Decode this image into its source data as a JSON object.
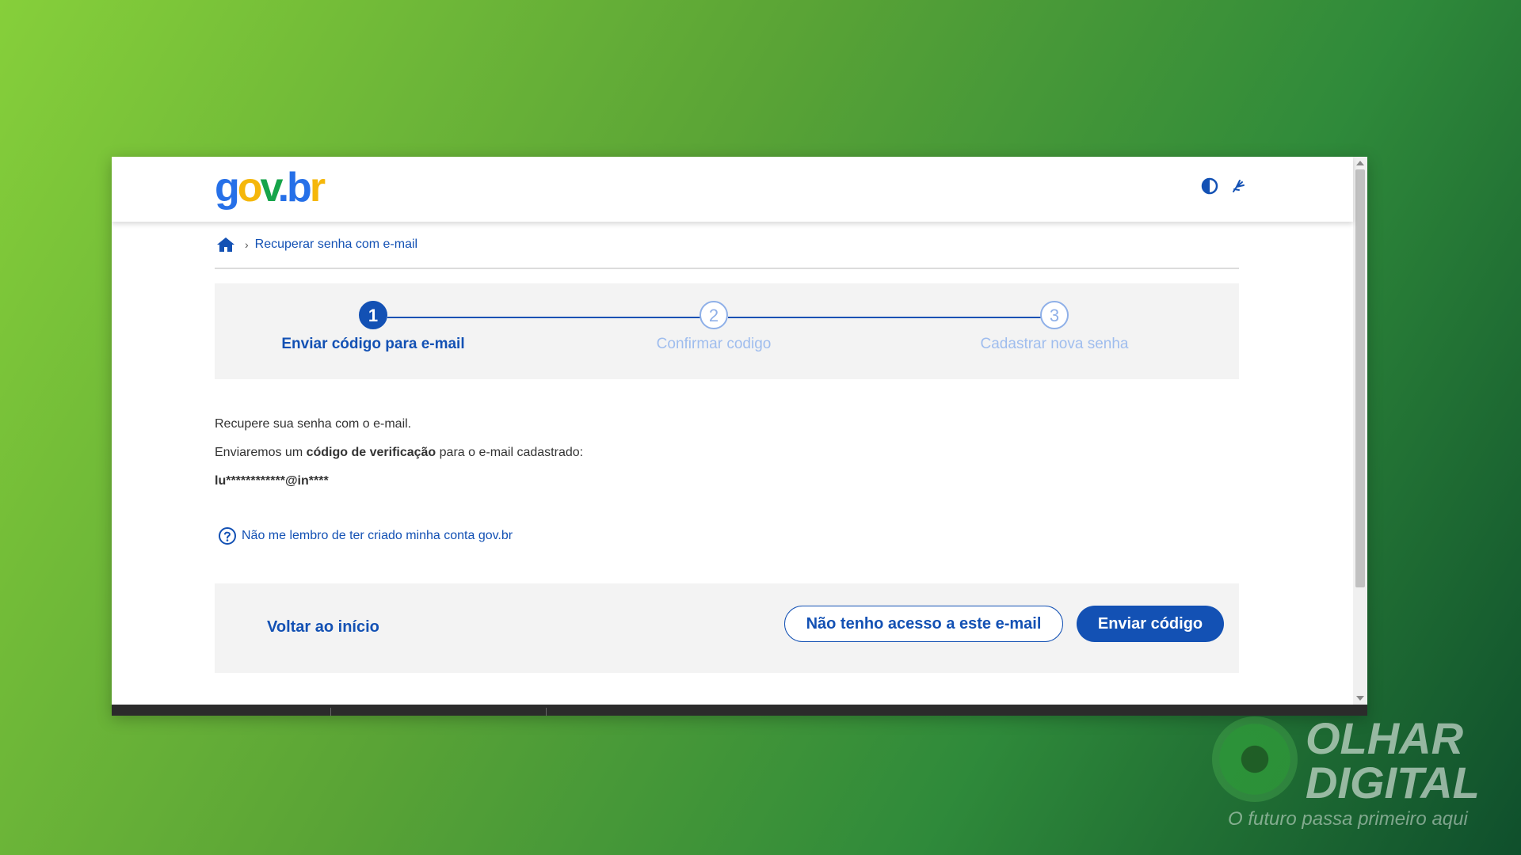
{
  "header": {
    "logo_text": "gov.br",
    "contrast_icon": "contrast-icon",
    "accessibility_icon": "sign-language-icon"
  },
  "breadcrumb": {
    "home_icon": "home-icon",
    "separator": "›",
    "current": "Recuperar senha com e-mail"
  },
  "steps": [
    {
      "number": "1",
      "label": "Enviar código para e-mail",
      "state": "active"
    },
    {
      "number": "2",
      "label": "Confirmar codigo",
      "state": "inactive"
    },
    {
      "number": "3",
      "label": "Cadastrar nova senha",
      "state": "inactive"
    }
  ],
  "body": {
    "line1": "Recupere sua senha com o e-mail.",
    "line2_prefix": "Enviaremos um ",
    "line2_bold": "código de verificação",
    "line2_suffix": " para o e-mail cadastrado:",
    "masked_email": "lu************@in****"
  },
  "help_link": {
    "icon": "question-circle-icon",
    "label": "Não me lembro de ter criado minha conta gov.br"
  },
  "actions": {
    "back_label": "Voltar ao início",
    "no_access_label": "Não tenho acesso a este e-mail",
    "send_label": "Enviar código"
  },
  "watermark": {
    "line1": "OLHAR",
    "line2": "DIGITAL",
    "tagline": "O futuro passa primeiro aqui"
  },
  "colors": {
    "primary": "#1351b4",
    "inactive_step": "#8fb0e8"
  }
}
